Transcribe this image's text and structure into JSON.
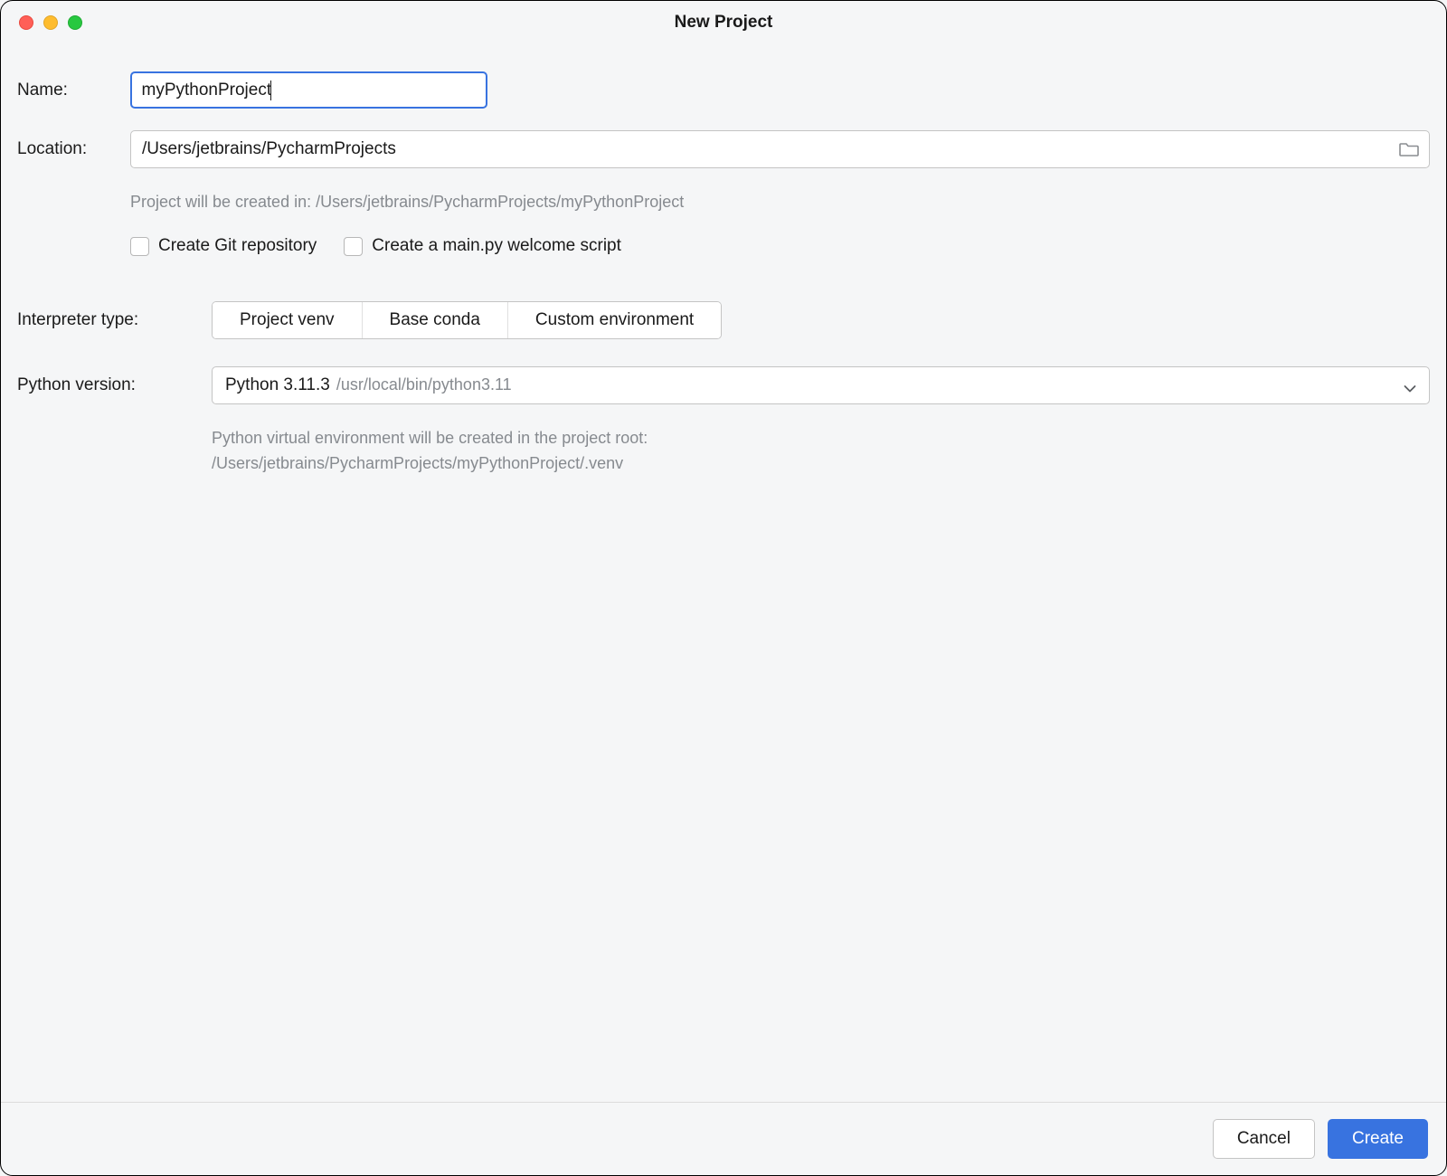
{
  "window": {
    "title": "New Project"
  },
  "fields": {
    "name_label": "Name:",
    "name_value": "myPythonProject",
    "location_label": "Location:",
    "location_value": "/Users/jetbrains/PycharmProjects",
    "location_hint": "Project will be created in: /Users/jetbrains/PycharmProjects/myPythonProject"
  },
  "checkboxes": {
    "git_label": "Create Git repository",
    "git_checked": false,
    "mainpy_label": "Create a main.py welcome script",
    "mainpy_checked": false
  },
  "interpreter": {
    "type_label": "Interpreter type:",
    "options": [
      "Project venv",
      "Base conda",
      "Custom environment"
    ],
    "selected": "Project venv"
  },
  "python_version": {
    "label": "Python version:",
    "value": "Python 3.11.3",
    "path": "/usr/local/bin/python3.11",
    "hint_line1": "Python virtual environment will be created in the project root:",
    "hint_line2": "/Users/jetbrains/PycharmProjects/myPythonProject/.venv"
  },
  "footer": {
    "cancel": "Cancel",
    "create": "Create"
  }
}
